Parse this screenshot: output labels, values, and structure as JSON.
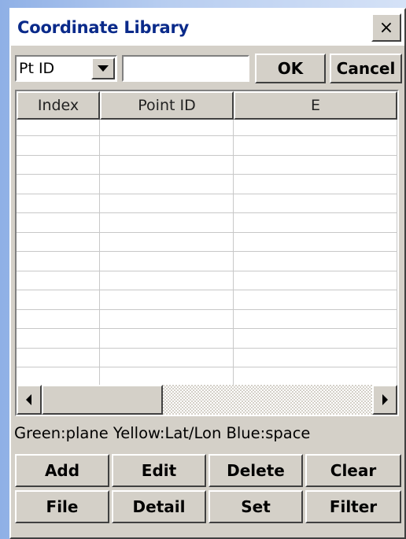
{
  "window": {
    "title": "Coordinate Library",
    "close_label": "×"
  },
  "filter": {
    "field_value": "Pt ID",
    "search_value": "",
    "ok_label": "OK",
    "cancel_label": "Cancel"
  },
  "table": {
    "columns": [
      "Index",
      "Point ID",
      "E"
    ],
    "rows": [
      [],
      [],
      [],
      [],
      [],
      [],
      [],
      [],
      [],
      [],
      [],
      [],
      [],
      []
    ]
  },
  "legend": "Green:plane Yellow:Lat/Lon  Blue:space",
  "buttons": {
    "add": "Add",
    "edit": "Edit",
    "delete": "Delete",
    "clear": "Clear",
    "file": "File",
    "detail": "Detail",
    "set": "Set",
    "filter": "Filter"
  },
  "colors": {
    "title_text": "#0a2a8a",
    "window_face": "#d4d0c8",
    "desktop": "#b7cdf0"
  },
  "icons": {
    "close": "close-icon",
    "dropdown": "chevron-down-icon",
    "scroll_left": "arrow-left-icon",
    "scroll_right": "arrow-right-icon"
  }
}
